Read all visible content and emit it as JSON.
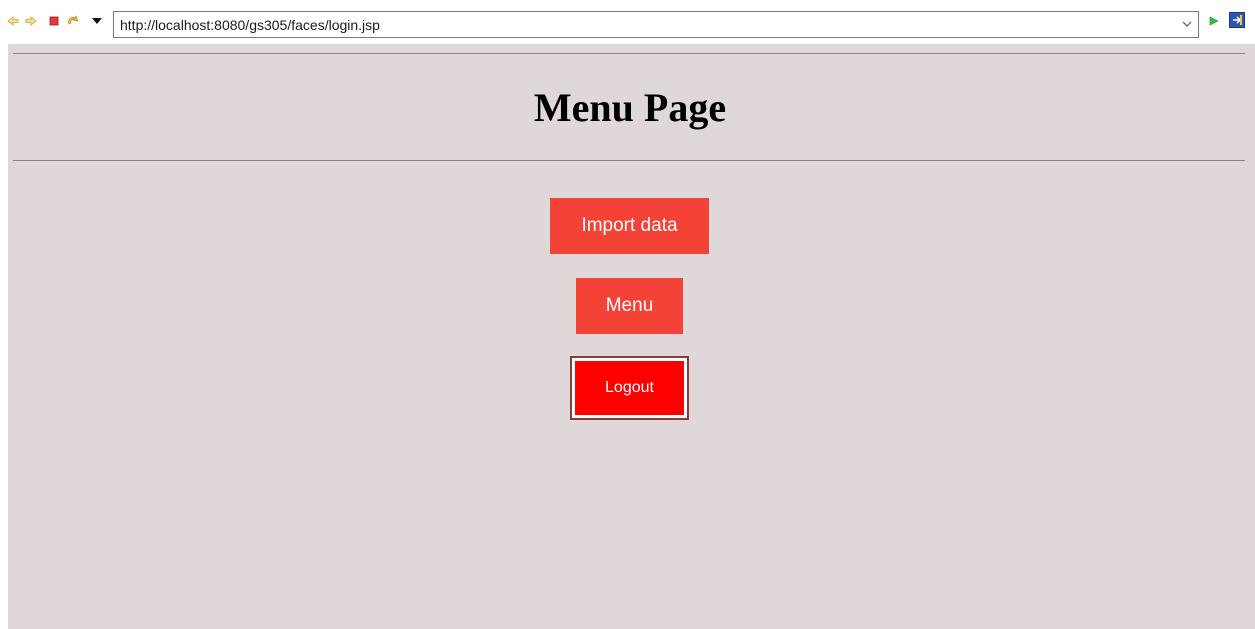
{
  "browser": {
    "url": "http://localhost:8080/gs305/faces/login.jsp",
    "icons": [
      "back-icon",
      "forward-icon",
      "stop-icon",
      "refresh-icon",
      "dropdown-arrow-icon",
      "url-dropdown-icon",
      "go-icon",
      "external-browser-icon"
    ]
  },
  "page": {
    "title": "Menu Page",
    "background_color": "#e0d7d8",
    "buttons": {
      "import_label": "Import data",
      "menu_label": "Menu",
      "logout_label": "Logout"
    },
    "colors": {
      "primary_button": "#f44336",
      "logout_button": "#ff0000"
    }
  }
}
